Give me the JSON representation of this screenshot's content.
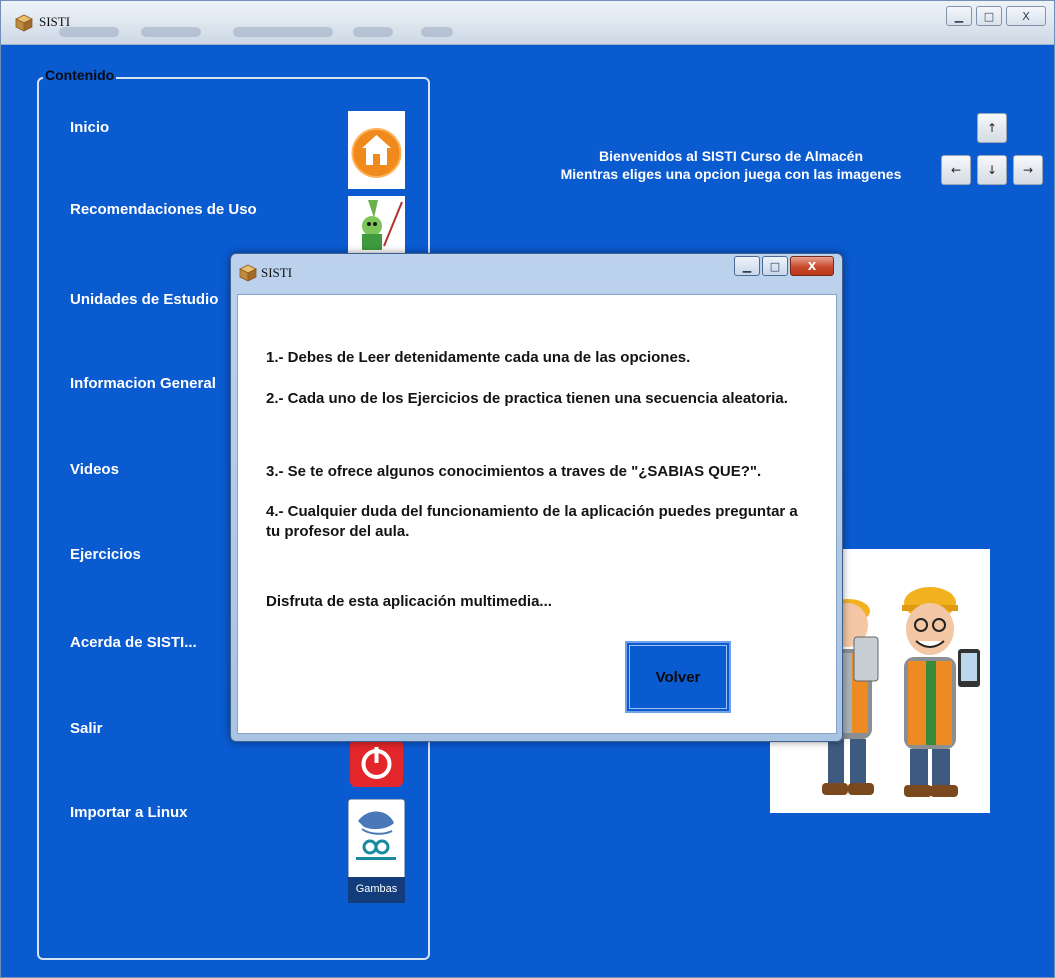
{
  "window": {
    "title": "SISTI",
    "minimize_label": "▁",
    "maximize_label": "□",
    "close_label": "X"
  },
  "sidebar": {
    "legend": "Contenido",
    "items": [
      {
        "label": "Inicio",
        "icon": "home-icon"
      },
      {
        "label": "Recomendaciones de Uso",
        "icon": "wizard-icon"
      },
      {
        "label": "Unidades de Estudio",
        "icon": "book-icon"
      },
      {
        "label": "Informacion General",
        "icon": "info-icon"
      },
      {
        "label": "Videos",
        "icon": "video-icon"
      },
      {
        "label": "Ejercicios",
        "icon": "exercise-icon"
      },
      {
        "label": "Acerda de SISTI...",
        "icon": "about-icon"
      },
      {
        "label": "Salir",
        "icon": "power-icon"
      },
      {
        "label": "Importar a Linux",
        "icon": "gambas-icon",
        "caption": "Gambas"
      }
    ]
  },
  "welcome": {
    "line1": "Bienvenidos al SISTI Curso de Almacén",
    "line2": "Mientras eliges una opcion juega con las imagenes"
  },
  "arrows": {
    "up": "↑",
    "left": "←",
    "down": "↓",
    "right": "→"
  },
  "dialog": {
    "title": "SISTI",
    "minimize_label": "▁",
    "maximize_label": "□",
    "close_label": "X",
    "paragraphs": [
      "1.- Debes de Leer detenidamente cada una de las opciones.",
      "2.- Cada uno de los Ejercicios de practica tienen una secuencia aleatoria.",
      "3.- Se te ofrece algunos conocimientos a traves de \"¿SABIAS QUE?\".",
      "4.- Cualquier duda del funcionamiento de la aplicación puedes preguntar a tu profesor del aula.",
      "Disfruta de esta aplicación multimedia..."
    ],
    "button_label": "Volver"
  },
  "colors": {
    "background": "#0a5ad0",
    "text_light": "#ffffff"
  }
}
